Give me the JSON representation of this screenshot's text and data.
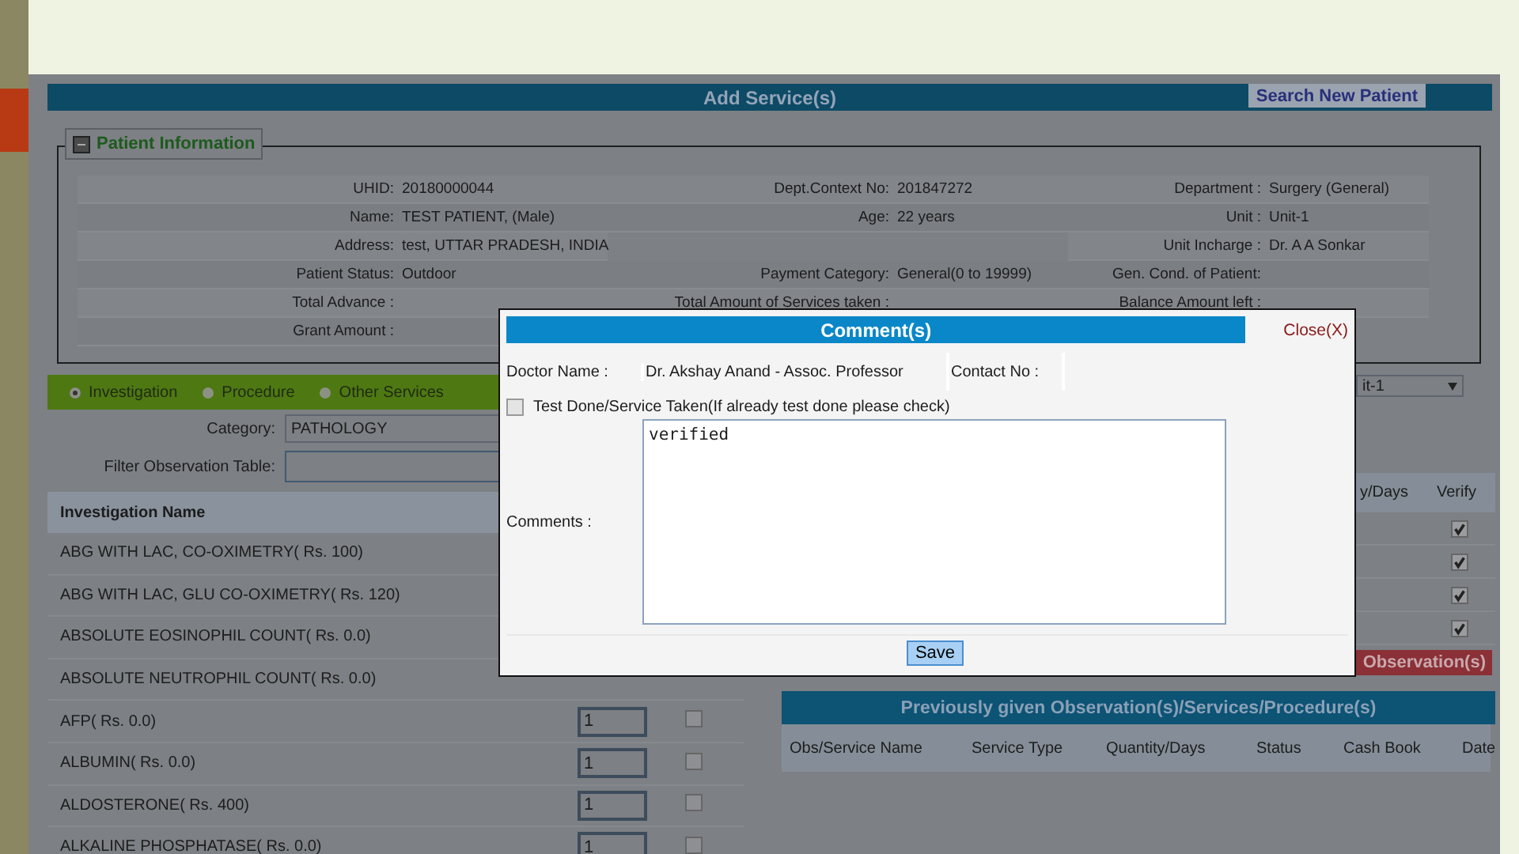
{
  "header": {
    "title": "Add Service(s)",
    "search_button": "Search New Patient"
  },
  "patient_info": {
    "legend": "Patient Information",
    "rows": [
      {
        "left": {
          "label": "UHID:",
          "value": "20180000044"
        },
        "middle": {
          "label": "Dept.Context No:",
          "value": "201847272"
        },
        "right": {
          "label": "Department :",
          "value": "Surgery (General)"
        }
      },
      {
        "left": {
          "label": "Name:",
          "value": "TEST PATIENT, (Male)"
        },
        "middle": {
          "label": "Age:",
          "value": "22 years"
        },
        "right": {
          "label": "Unit :",
          "value": "Unit-1"
        }
      },
      {
        "left": {
          "label": "Address:",
          "value": "test, UTTAR PRADESH, INDIA"
        },
        "right": {
          "label": "Unit Incharge :",
          "value": "Dr. A A Sonkar"
        }
      },
      {
        "left": {
          "label": "Patient Status:",
          "value": "Outdoor"
        },
        "middle": {
          "label": "Payment Category:",
          "value": "General(0 to 19999)"
        },
        "right": {
          "label": "Gen. Cond. of Patient:"
        }
      },
      {
        "left": {
          "label": "Total Advance :"
        },
        "middle": {
          "label": "Total Amount of Services taken :"
        },
        "right": {
          "label": "Balance Amount left :"
        }
      },
      {
        "left": {
          "label": "Grant Amount :"
        }
      }
    ]
  },
  "service_types": [
    {
      "label": "Investigation",
      "selected": true
    },
    {
      "label": "Procedure",
      "selected": false
    },
    {
      "label": "Other Services",
      "selected": false
    }
  ],
  "category": {
    "label": "Category:",
    "value": "PATHOLOGY"
  },
  "filter": {
    "label": "Filter Observation Table:"
  },
  "investigations": {
    "header": "Investigation Name",
    "rows": [
      {
        "name": "ABG WITH LAC, CO-OXIMETRY( Rs. 100)"
      },
      {
        "name": "ABG WITH LAC, GLU CO-OXIMETRY( Rs. 120)"
      },
      {
        "name": "ABSOLUTE EOSINOPHIL COUNT( Rs. 0.0)"
      },
      {
        "name": "ABSOLUTE NEUTROPHIL COUNT( Rs. 0.0)"
      },
      {
        "name": "AFP( Rs. 0.0)",
        "quantity": "1",
        "checked": false
      },
      {
        "name": "ALBUMIN( Rs. 0.0)",
        "quantity": "1",
        "checked": false
      },
      {
        "name": "ALDOSTERONE( Rs. 400)",
        "quantity": "1",
        "checked": false
      },
      {
        "name": "ALKALINE PHOSPHATASE( Rs. 0.0)",
        "quantity": "1",
        "checked": false
      }
    ]
  },
  "unit_select": {
    "value": "it-1"
  },
  "selected_table": {
    "columns": [
      "y/Days",
      "Verify"
    ],
    "rows": [
      {
        "checked": true
      },
      {
        "checked": true
      },
      {
        "checked": true
      },
      {
        "checked": true
      }
    ]
  },
  "observation_button": "Observation(s)",
  "previous": {
    "title": "Previously given Observation(s)/Services/Procedure(s)",
    "columns": [
      "Obs/Service Name",
      "Service Type",
      "Quantity/Days",
      "Status",
      "Cash Book",
      "Date"
    ]
  },
  "modal": {
    "title": "Comment(s)",
    "close": "Close(X)",
    "doctor_label": "Doctor Name :",
    "doctor": "Dr. Akshay Anand - Assoc. Professor",
    "contact_label": "Contact No :",
    "test_done": {
      "label": "Test Done/Service Taken(If already test done please check)",
      "checked": false
    },
    "comments_label": "Comments :",
    "comments": "verified",
    "save": "Save"
  }
}
